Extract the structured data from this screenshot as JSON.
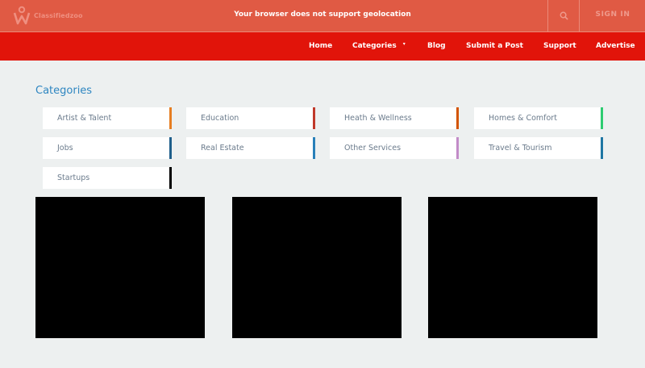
{
  "header": {
    "logo_text": "Classifiedzoo",
    "geolocation_message": "Your browser does not support geolocation",
    "search_icon": "search-icon",
    "signin_label": "SIGN IN"
  },
  "nav": {
    "home": "Home",
    "categories": "Categories",
    "categories_caret": "▾",
    "blog": "Blog",
    "submit_post": "Submit a Post",
    "support": "Support",
    "advertise": "Advertise"
  },
  "main": {
    "section_title": "Categories",
    "categories": [
      {
        "label": "Artist & Talent",
        "accent": "#e67e22"
      },
      {
        "label": "Education",
        "accent": "#c0392b"
      },
      {
        "label": "Heath & Wellness",
        "accent": "#d35400"
      },
      {
        "label": "Homes & Comfort",
        "accent": "#2ecc71"
      },
      {
        "label": "Jobs",
        "accent": "#1f5f8b"
      },
      {
        "label": "Real Estate",
        "accent": "#2980b9"
      },
      {
        "label": "Other Services",
        "accent": "#c28bc8"
      },
      {
        "label": "Travel & Tourism",
        "accent": "#1f77a3"
      },
      {
        "label": "Startups",
        "accent": "#000000"
      }
    ]
  },
  "colors": {
    "topbar": "#e05a44",
    "navbar": "#e1140a",
    "background": "#edf0f0",
    "title": "#2e86c1"
  }
}
